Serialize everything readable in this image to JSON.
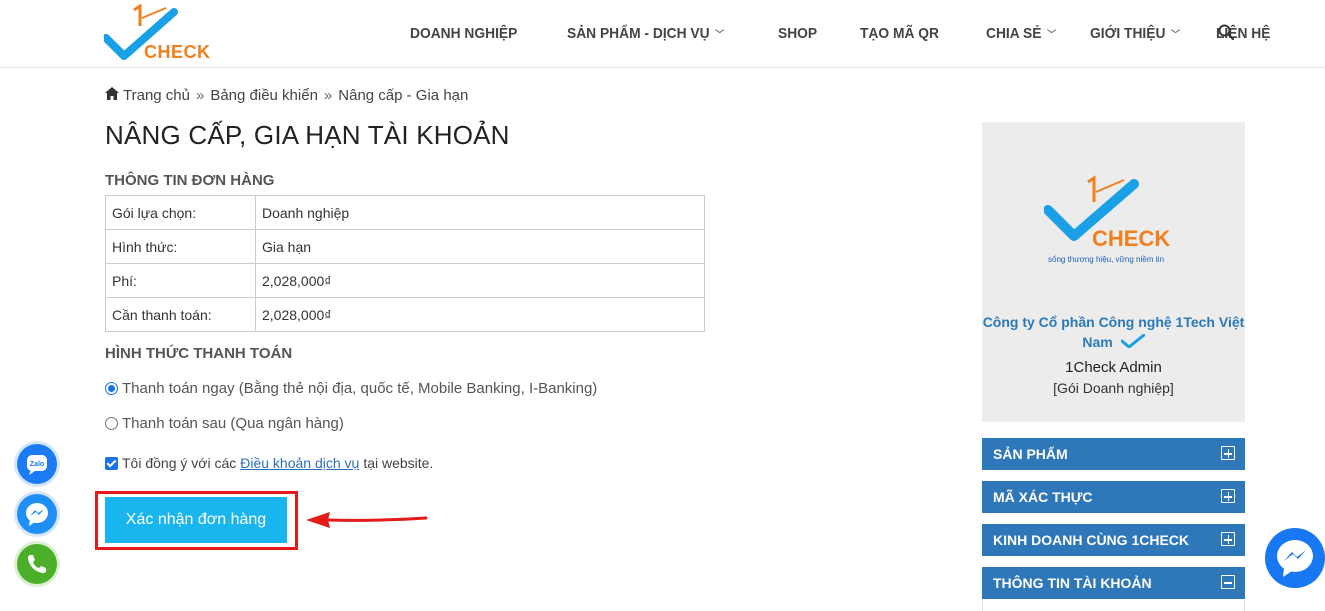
{
  "header": {
    "logo_text": "CHECK",
    "nav": [
      {
        "label": "DOANH NGHIỆP",
        "has_dropdown": false
      },
      {
        "label": "SẢN PHẨM - DỊCH VỤ",
        "has_dropdown": true
      },
      {
        "label": "SHOP",
        "has_dropdown": false
      },
      {
        "label": "TẠO MÃ QR",
        "has_dropdown": false
      },
      {
        "label": "CHIA SẺ",
        "has_dropdown": true
      },
      {
        "label": "GIỚI THIỆU",
        "has_dropdown": true
      },
      {
        "label": "LIÊN HỆ",
        "has_dropdown": false
      }
    ],
    "search_icon": "search-icon"
  },
  "breadcrumb": {
    "home": "Trang chủ",
    "sep": "»",
    "dashboard": "Bảng điều khiển",
    "current": "Nâng cấp - Gia hạn"
  },
  "page_title": "NÂNG CẤP, GIA HẠN TÀI KHOẢN",
  "order": {
    "section_title": "THÔNG TIN ĐƠN HÀNG",
    "rows": [
      {
        "key": "Gói lựa chọn:",
        "value": "Doanh nghiệp"
      },
      {
        "key": "Hình thức:",
        "value": "Gia hạn"
      },
      {
        "key": "Phí:",
        "value": "2,028,000₫"
      },
      {
        "key": "Cần thanh toán:",
        "value": "2,028,000₫"
      }
    ]
  },
  "payment": {
    "section_title": "HÌNH THỨC THANH TOÁN",
    "options": [
      {
        "label": "Thanh toán ngay (Bằng thẻ nội địa, quốc tế, Mobile Banking, I-Banking)",
        "checked": true
      },
      {
        "label": "Thanh toán sau (Qua ngân hàng)",
        "checked": false
      }
    ]
  },
  "agree": {
    "prefix": "Tôi đồng ý với các",
    "link": "Điều khoản dịch vụ",
    "suffix": "tại website.",
    "checked": true
  },
  "confirm_button": "Xác nhận đơn hàng",
  "sidebar": {
    "card_logo_text": "CHECK",
    "slogan": "sống thương hiệu, vững niềm tin",
    "company": "Công ty Cổ phần Công nghệ 1Tech Việt Nam",
    "admin_name": "1Check Admin",
    "plan": "[Gói Doanh nghiệp]",
    "menu": [
      {
        "label": "SẢN PHẨM",
        "expanded": false
      },
      {
        "label": "MÃ XÁC THỰC",
        "expanded": false
      },
      {
        "label": "KINH DOANH CÙNG 1CHECK",
        "expanded": false
      },
      {
        "label": "THÔNG TIN TÀI KHOẢN",
        "expanded": true
      }
    ]
  },
  "floating": [
    "zalo-icon",
    "messenger-icon",
    "phone-icon"
  ],
  "colors": {
    "primary_blue": "#2e77b8",
    "button_cyan": "#19b5ee",
    "highlight_red": "#e31b1b",
    "brand_orange": "#f07f1e"
  }
}
